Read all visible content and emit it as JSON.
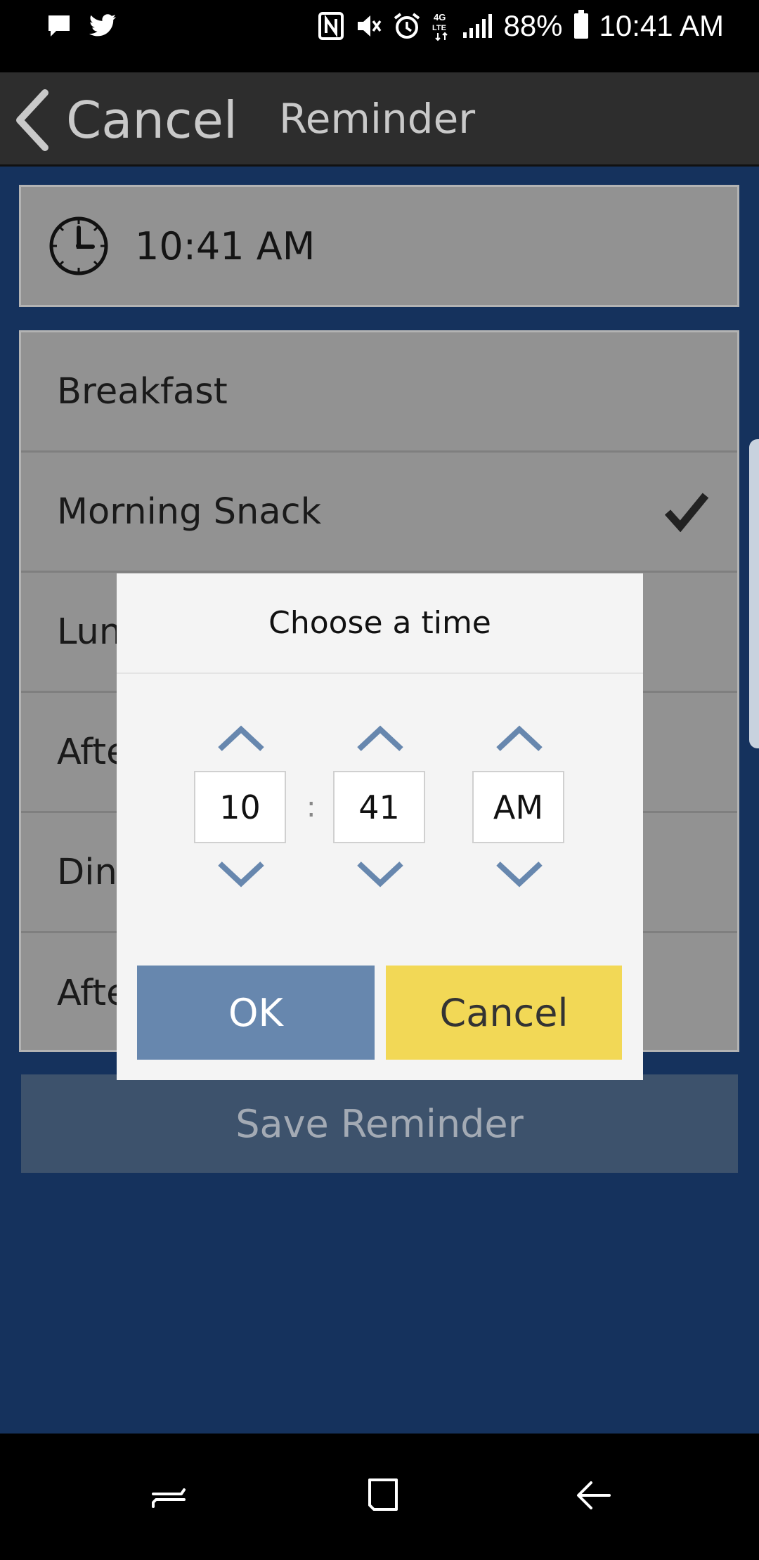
{
  "status_bar": {
    "battery": "88%",
    "time": "10:41 AM",
    "network": "4G LTE",
    "left_icons": [
      "message-icon",
      "twitter-icon"
    ],
    "right_icons": [
      "nfc-icon",
      "mute-icon",
      "alarm-icon",
      "lte-icon",
      "signal-icon",
      "battery-icon"
    ]
  },
  "header": {
    "back_label": "Cancel",
    "title": "Reminder"
  },
  "time_row": {
    "icon": "clock-icon",
    "value": "10:41 AM"
  },
  "meals": [
    {
      "label": "Breakfast",
      "checked": false
    },
    {
      "label": "Morning Snack",
      "checked": true
    },
    {
      "label": "Lunch",
      "checked": false
    },
    {
      "label": "Afternoon Snack",
      "checked": false
    },
    {
      "label": "Dinner",
      "checked": false
    },
    {
      "label": "After Dinner Snack",
      "checked": false
    }
  ],
  "save_label": "Save Reminder",
  "dialog": {
    "title": "Choose a time",
    "hour": "10",
    "separator": ":",
    "minute": "41",
    "period": "AM",
    "ok_label": "OK",
    "cancel_label": "Cancel"
  },
  "colors": {
    "background": "#15325d",
    "header": "#2d2d2d",
    "ok_button": "#6787ae",
    "cancel_button": "#f2d856",
    "arrow": "#6787ae"
  },
  "nav_bar": [
    "recents-icon",
    "home-icon",
    "back-icon"
  ]
}
